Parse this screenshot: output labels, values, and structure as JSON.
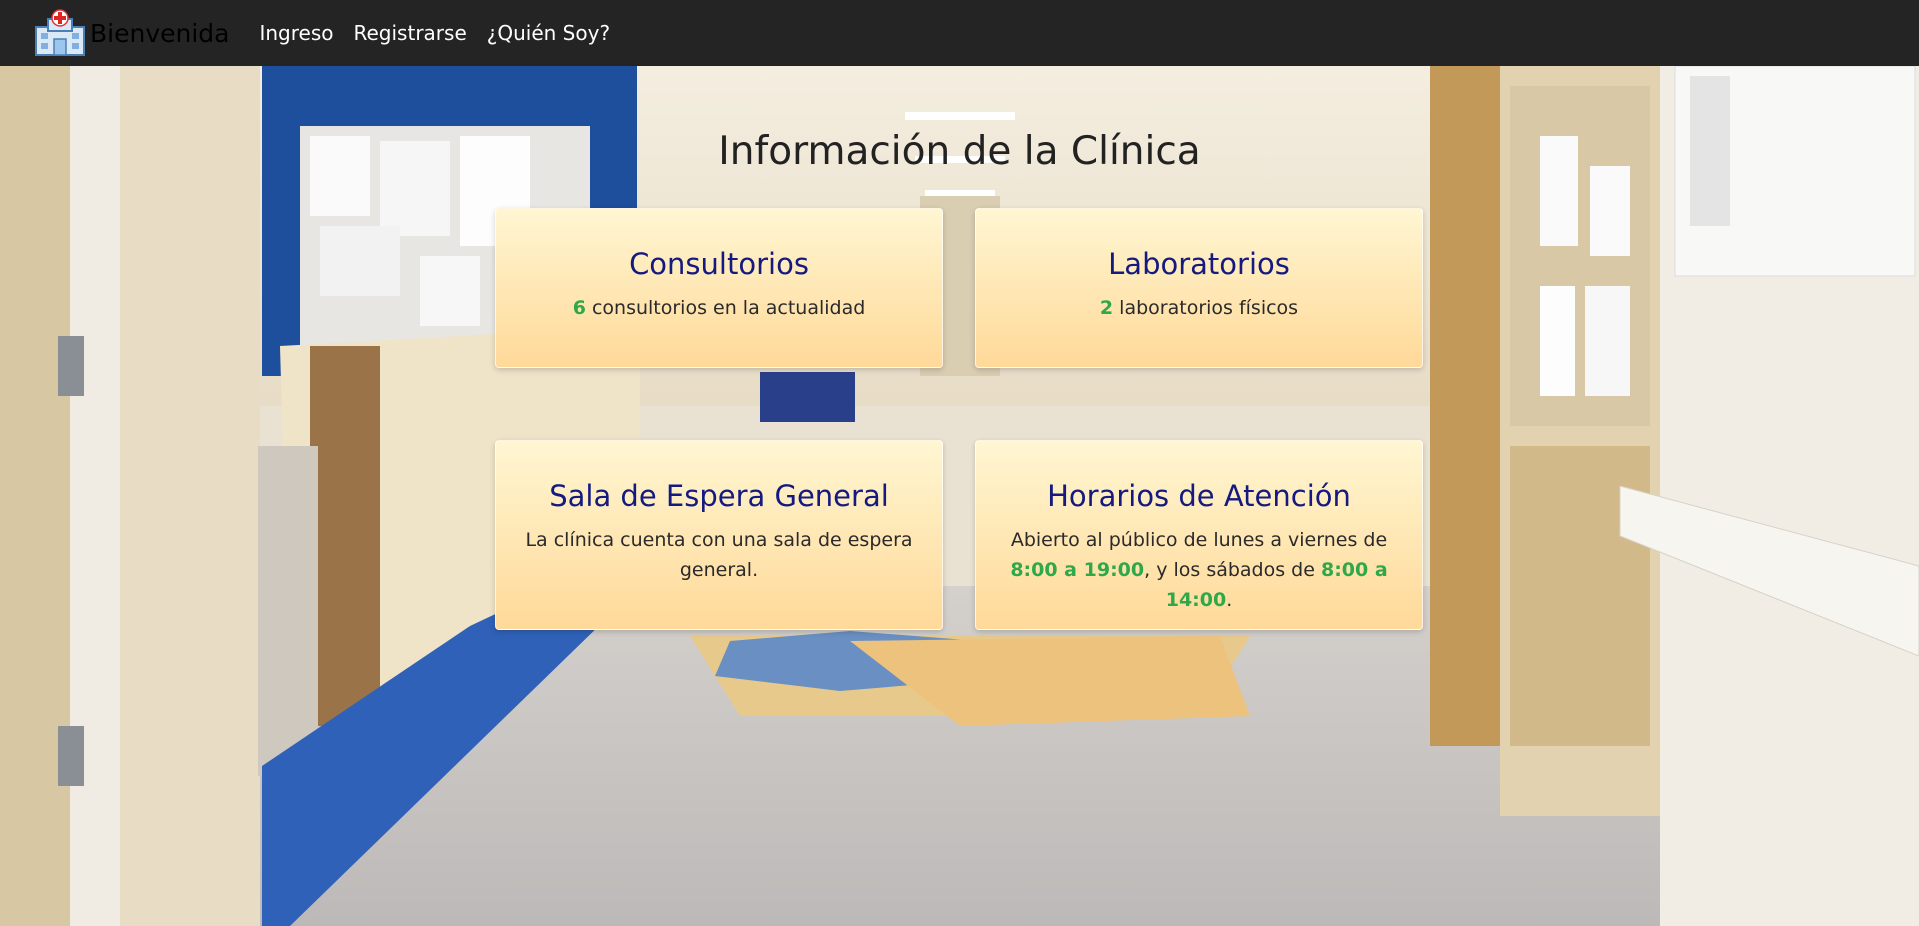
{
  "navbar": {
    "brand": "Bienvenida",
    "links": [
      "Ingreso",
      "Registrarse",
      "¿Quién Soy?"
    ]
  },
  "main": {
    "title": "Información de la Clínica",
    "cards": [
      {
        "title": "Consultorios",
        "count": "6",
        "text": " consultorios en la actualidad"
      },
      {
        "title": "Laboratorios",
        "count": "2",
        "text": " laboratorios físicos"
      },
      {
        "title": "Sala de Espera General",
        "text": "La clínica cuenta con una sala de espera general."
      },
      {
        "title": "Horarios de Atención",
        "text_1": "Abierto al público de lunes a viernes de ",
        "hours_weekday": "8:00 a 19:00",
        "text_2": ", y los sábados de ",
        "hours_saturday": "8:00 a 14:00",
        "text_3": "."
      }
    ]
  },
  "icons": {
    "brand_logo": "hospital-icon"
  },
  "colors": {
    "navbar": "#242424",
    "card_title": "#141a80",
    "highlight": "#2fa84a",
    "card_top": "#fff6d2",
    "card_bottom": "#ffd999"
  }
}
